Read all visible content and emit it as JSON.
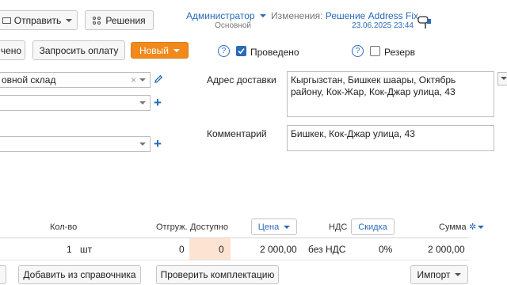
{
  "toolbar": {
    "send_label": "Отправить",
    "solutions_label": "Решения",
    "posted_label": "чено",
    "request_payment_label": "Запросить оплату",
    "status_label": "Новый"
  },
  "header": {
    "user_name": "Администратор",
    "user_role": "Основной",
    "changes_prefix": "Изменения:",
    "changes_link": "Решение Address Fix",
    "changes_date": "23.06.2025 23:44"
  },
  "flags": {
    "help_glyph": "?",
    "posted": {
      "label": "Проведено",
      "checked": true
    },
    "reserve": {
      "label": "Резерв",
      "checked": false
    }
  },
  "form": {
    "warehouse_value": "овной склад",
    "delivery_label": "Адрес доставки",
    "delivery_value": "Кыргызстан, Бишкек шаары, Октябрь району, Кок-Жар, Кок-Джар улица, 43",
    "comment_label": "Комментарий",
    "comment_value": "Бишкек, Кок-Джар улица, 43"
  },
  "table": {
    "headers": {
      "qty": "Кол-во",
      "shipped": "Отгруж.",
      "available": "Доступно",
      "price": "Цена",
      "vat": "НДС",
      "discount": "Скидка",
      "sum": "Сумма"
    },
    "rows": [
      {
        "qty": "1",
        "unit": "шт",
        "shipped": "0",
        "available": "0",
        "price": "2 000,00",
        "vat": "без НДС",
        "discount": "0%",
        "sum": "2 000,00"
      }
    ]
  },
  "footer": {
    "add_from_catalog_label": "Добавить из справочника",
    "check_kit_label": "Проверить комплектацию",
    "import_label": "Импорт"
  },
  "colors": {
    "accent": "#2a6ab8",
    "status_orange": "#f08a1c",
    "available_highlight": "#fde3d2"
  }
}
